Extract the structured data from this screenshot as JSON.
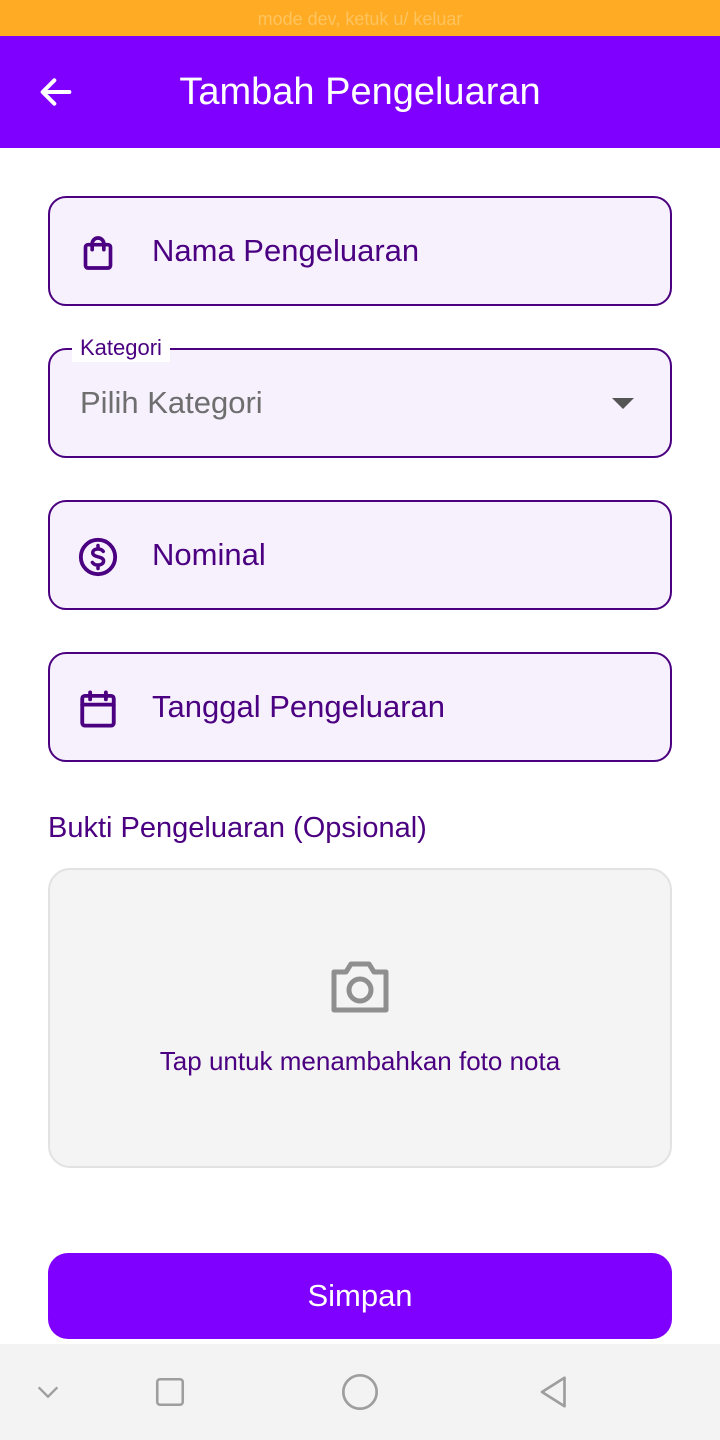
{
  "status_bar": {
    "text": "mode dev, ketuk u/ keluar"
  },
  "app_bar": {
    "title": "Tambah Pengeluaran",
    "back_icon": "arrow-left-icon"
  },
  "form": {
    "name_field": {
      "placeholder": "Nama Pengeluaran",
      "icon": "shopping-bag-icon"
    },
    "category_field": {
      "label": "Kategori",
      "value": "Pilih Kategori",
      "icon": "dropdown-arrow-icon"
    },
    "amount_field": {
      "placeholder": "Nominal",
      "icon": "dollar-circle-icon"
    },
    "date_field": {
      "placeholder": "Tanggal Pengeluaran",
      "icon": "calendar-icon"
    }
  },
  "receipt": {
    "label": "Bukti Pengeluaran (Opsional)",
    "upload_hint": "Tap untuk menambahkan foto nota",
    "icon": "camera-icon"
  },
  "actions": {
    "save_label": "Simpan"
  },
  "nav_bar": {
    "icons": [
      "chevron-down-icon",
      "square-icon",
      "circle-icon",
      "triangle-back-icon"
    ]
  },
  "colors": {
    "primary": "#8000FF",
    "text_dark_purple": "#4A0080",
    "field_bg": "#F7F0FD",
    "status_bar": "#FFAB24"
  }
}
